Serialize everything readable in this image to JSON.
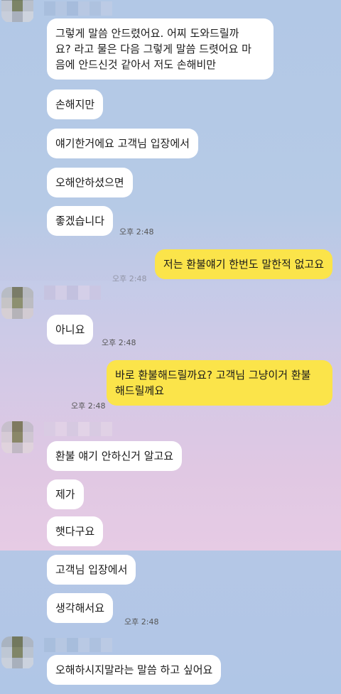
{
  "messages": [
    {
      "text": "그렇게 말씀 안드렸어요. 어찌 도와드릴까\n요? 라고 물은 다음 그렇게 말씀 드렷어요 마\n음에 안드신것 같아서 저도 손해비만"
    },
    {
      "text": "손해지만"
    },
    {
      "text": "얘기한거에요 고객님 입장에서"
    },
    {
      "text": "오해안하셨으면"
    },
    {
      "text": "좋겠습니다"
    },
    {
      "text": "저는 환불얘기 한번도 말한적 없고요"
    },
    {
      "text": "아니요"
    },
    {
      "text": "바로 환불해드릴까요? 고객님 그냥이거 환불\n해드릴께요"
    },
    {
      "text": "환불 얘기 안하신거 알고요"
    },
    {
      "text": "제가"
    },
    {
      "text": "햇다구요"
    },
    {
      "text": "고객님 입장에서"
    },
    {
      "text": "생각해서요"
    },
    {
      "text": "오해하시지말라는 말씀 하고 싶어요"
    }
  ],
  "times": {
    "t1": "오후 2:48",
    "t2": "오후 2:48",
    "t3": "오후 2:48",
    "t4": "오후 2:48",
    "t5": "오후 2:48",
    "t6": "오후 2:48"
  },
  "colors": {
    "incoming": "#ffffff",
    "outgoing": "#fbe44a",
    "background": "#b2c8e6"
  }
}
